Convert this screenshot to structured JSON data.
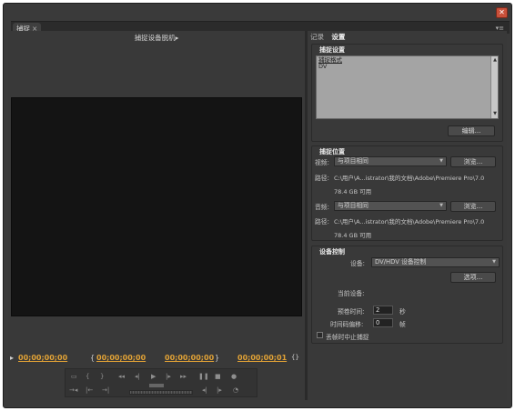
{
  "window": {
    "close_glyph": "✕",
    "tab_label": "捕捉",
    "tab_close": "×",
    "panel_menu": "▾≡"
  },
  "left": {
    "device_title": "捕捉设备脱机",
    "device_title_arrow": "▸",
    "timecodes": {
      "current": "00;00;00;00",
      "in": "00;00;00;00",
      "out": "00;00;00;00",
      "duration": "00;00;00;01"
    },
    "controls": {
      "icons": [
        "set-in-icon",
        "set-out-icon",
        "go-to-in-icon",
        "go-to-out-icon",
        "rewind-icon",
        "step-back-icon",
        "play-icon",
        "step-forward-icon",
        "fast-forward-icon",
        "pause-icon",
        "stop-icon",
        "record-icon"
      ]
    }
  },
  "right": {
    "tabs": [
      {
        "label": "记录",
        "active": false
      },
      {
        "label": "设置",
        "active": true
      }
    ],
    "capture_settings": {
      "title": "捕捉设置",
      "format_label": "捕捉格式",
      "format_value": "DV",
      "edit_button": "编辑..."
    },
    "capture_location": {
      "title": "捕捉位置",
      "video_label": "视频:",
      "video_value": "与项目相同",
      "browse_label": "浏览...",
      "path_label": "路径:",
      "video_path": "C:\\用户\\A...istrator\\我的文档\\Adobe\\Premiere Pro\\7.0",
      "video_free": "78.4 GB 可用",
      "audio_label": "音频:",
      "audio_value": "与项目相同",
      "audio_path": "C:\\用户\\A...istrator\\我的文档\\Adobe\\Premiere Pro\\7.0",
      "audio_free": "78.4 GB 可用"
    },
    "device_control": {
      "title": "设备控制",
      "device_label": "设备:",
      "device_value": "DV/HDV 设备控制",
      "options_button": "选项...",
      "current_device_label": "当前设备:",
      "preroll_label": "预卷时间:",
      "preroll_value": "2",
      "preroll_unit": "秒",
      "timecode_offset_label": "时间码偏移:",
      "timecode_offset_value": "0",
      "timecode_offset_unit": "帧",
      "abort_label": "丢帧时中止捕捉",
      "abort_checked": false
    }
  },
  "colors": {
    "timecode": "#e1a236",
    "panel_bg": "#393939",
    "video_bg": "#141414",
    "close_red": "#c8503a"
  }
}
